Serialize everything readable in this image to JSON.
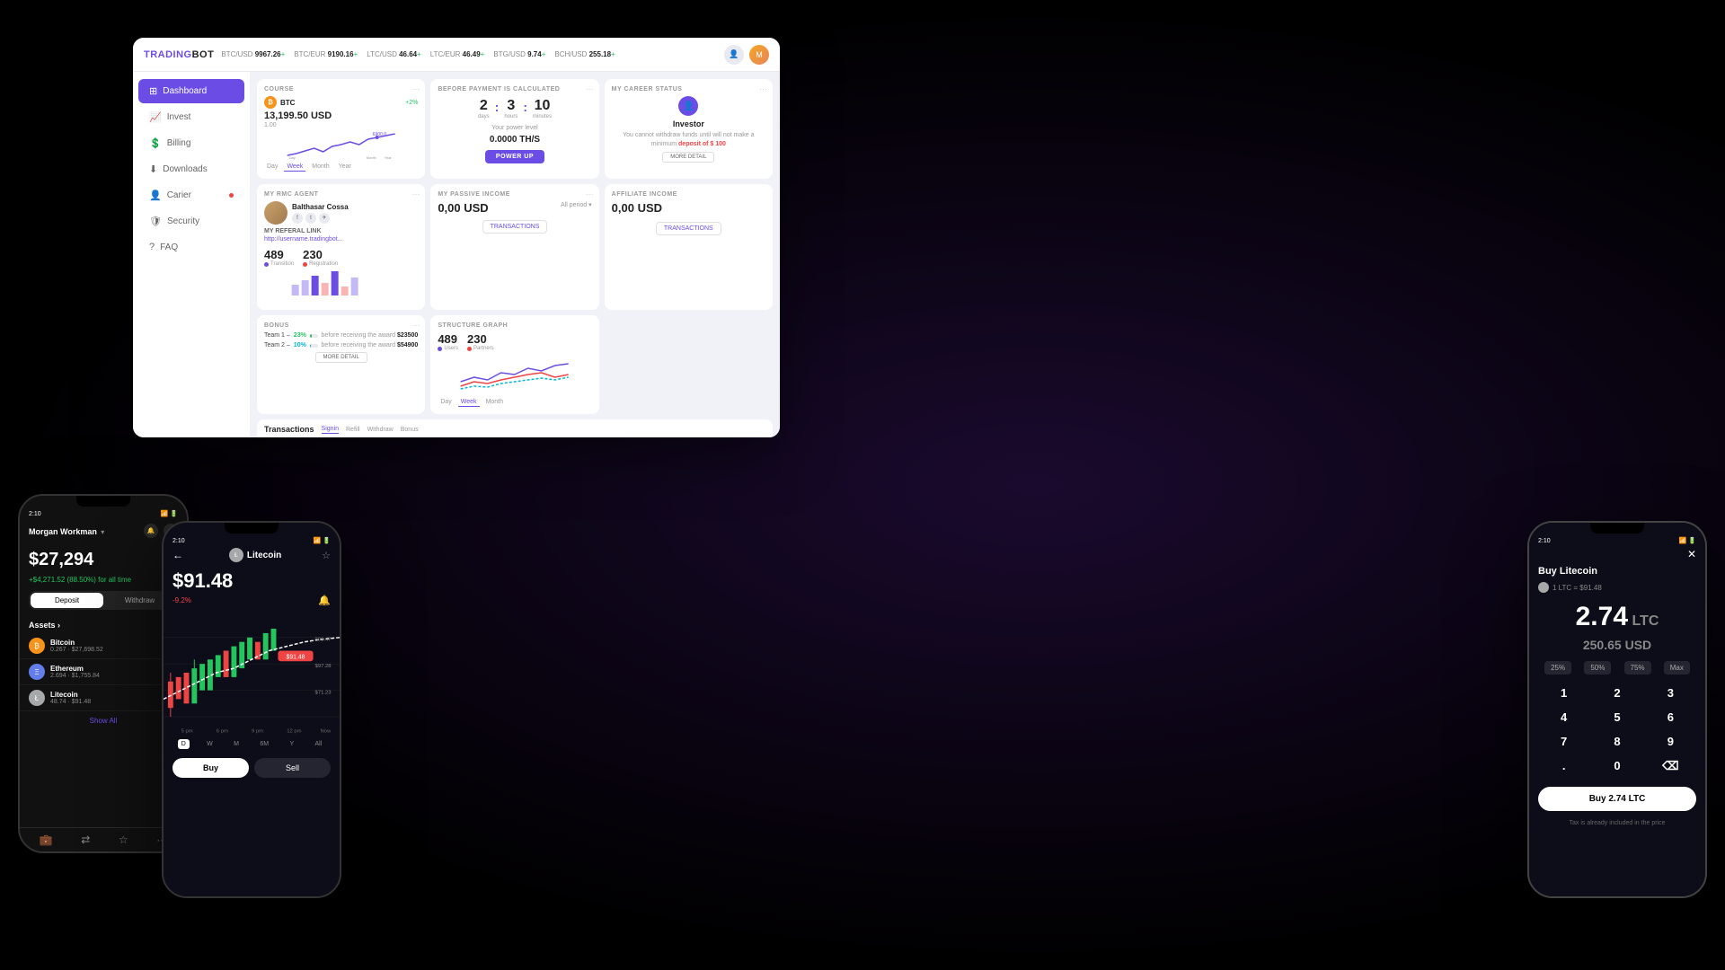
{
  "app": {
    "title": "TRADINGBOT",
    "title_trading": "TRADING",
    "title_bot": "BOT"
  },
  "ticker": [
    {
      "pair": "BTC/USD",
      "price": "9967.26",
      "change": "+",
      "color": "pos"
    },
    {
      "pair": "BTC/EUR",
      "price": "9190.16",
      "change": "+",
      "color": "pos"
    },
    {
      "pair": "LTC/USD",
      "price": "46.64",
      "change": "+",
      "color": "pos"
    },
    {
      "pair": "LTC/EUR",
      "price": "46.49",
      "change": "+",
      "color": "pos"
    },
    {
      "pair": "BTG/USD",
      "price": "9.74",
      "change": "+",
      "color": "pos"
    },
    {
      "pair": "BCH/USD",
      "price": "255.18",
      "change": "+",
      "color": "pos"
    }
  ],
  "sidebar": {
    "items": [
      {
        "label": "Dashboard",
        "icon": "⊞",
        "active": true
      },
      {
        "label": "Invest",
        "icon": "📈"
      },
      {
        "label": "Billing",
        "icon": "💲"
      },
      {
        "label": "Downloads",
        "icon": "⬇"
      },
      {
        "label": "Carier",
        "icon": "👤",
        "badge": true
      },
      {
        "label": "Security",
        "icon": "🛡"
      },
      {
        "label": "FAQ",
        "icon": "?"
      }
    ]
  },
  "course_card": {
    "title": "COURSE",
    "coin": "BTC",
    "price": "13,199.50 USD",
    "sub": "1.00",
    "change": "+2%"
  },
  "payment_card": {
    "title": "BEFORE PAYMENT IS CALCULATED",
    "days": "2",
    "hours": "3",
    "minutes": "10",
    "days_label": "days",
    "hours_label": "hours",
    "minutes_label": "minutes",
    "power_label": "Your power level",
    "power_value": "0.0000 TH/S",
    "button": "POWER UP"
  },
  "career_card": {
    "title": "MY CAREER STATUS",
    "level": "Investor",
    "desc": "You cannot withdraw funds until will not make a minimum deposit of $ 100",
    "highlight": "deposit of $ 100",
    "button": "MORE DETAIL"
  },
  "agent_card": {
    "title": "MY RMC AGENT",
    "name": "Balthasar Cossa",
    "referal_title": "MY REFERAL LINK",
    "referal_link": "http://username.tradingbot...",
    "stats": [
      {
        "num": "489",
        "label": "Transition",
        "color": "blue"
      },
      {
        "num": "230",
        "label": "Registration",
        "color": "red"
      }
    ]
  },
  "passive_card": {
    "title": "MY PASSIVE INCOME",
    "amount": "0,00 USD",
    "period": "All period",
    "button": "TRANSACTIONS"
  },
  "affiliate_card": {
    "title": "AFFILIATE INCOME",
    "amount": "0,00 USD",
    "button": "TRANSACTIONS"
  },
  "bonus_card": {
    "title": "BONUS",
    "teams": [
      {
        "label": "Team 1",
        "pct": "23%",
        "pct_val": 23,
        "award_text": "before receiving the award",
        "award_val": "$23500",
        "color": "green"
      },
      {
        "label": "Team 2",
        "pct": "10%",
        "pct_val": 10,
        "award_text": "before receiving the award",
        "award_val": "$54900",
        "color": "teal"
      }
    ],
    "button": "MORE DETAIL"
  },
  "structure_card": {
    "title": "STRUCTURE GRAPH",
    "stats": [
      {
        "num": "489",
        "label": "Users",
        "color": "blue"
      },
      {
        "num": "230",
        "label": "Partners",
        "color": "red"
      }
    ]
  },
  "transactions": {
    "title": "Transactions",
    "tabs": [
      "Signin",
      "Refill",
      "Withdraw",
      "Bonus"
    ]
  },
  "phone1": {
    "time": "2:10",
    "user": "Morgan Workman",
    "balance": "$27,294",
    "change": "+$4,271.52 (88.50%) for all time",
    "tabs": [
      "Deposit",
      "Withdraw"
    ],
    "assets_title": "Assets ›",
    "assets": [
      {
        "name": "Bitcoin",
        "amount": "0.267 · $27,698.52",
        "icon": "₿",
        "type": "btc",
        "change": "+"
      },
      {
        "name": "Ethereum",
        "amount": "2.694 · $1,755.84",
        "icon": "Ξ",
        "type": "eth",
        "change": "+"
      },
      {
        "name": "Litecoin",
        "amount": "48.74 · $91.48",
        "icon": "Ł",
        "type": "ltc",
        "change": "+"
      }
    ],
    "show_all": "Show All"
  },
  "phone2": {
    "time": "2:10",
    "coin": "Litecoin",
    "price": "$91.48",
    "change": "-9.2%",
    "time_tabs": [
      "D",
      "W",
      "M",
      "6M",
      "Y",
      "All"
    ],
    "buy": "Buy",
    "sell": "Sell"
  },
  "phone3": {
    "time": "2:10",
    "title": "Buy Litecoin",
    "coin_label": "1 LTC = $91.48",
    "amount": "2.74",
    "currency": "LTC",
    "usd_amount": "250.65",
    "usd_label": "USD",
    "pct_btns": [
      "25%",
      "50%",
      "75%",
      "Max"
    ],
    "numpad": [
      "1",
      "2",
      "3",
      "4",
      "5",
      "6",
      "7",
      "8",
      "9",
      ".",
      "0",
      "⌫"
    ],
    "buy_label": "Buy 2.74 LTC"
  }
}
